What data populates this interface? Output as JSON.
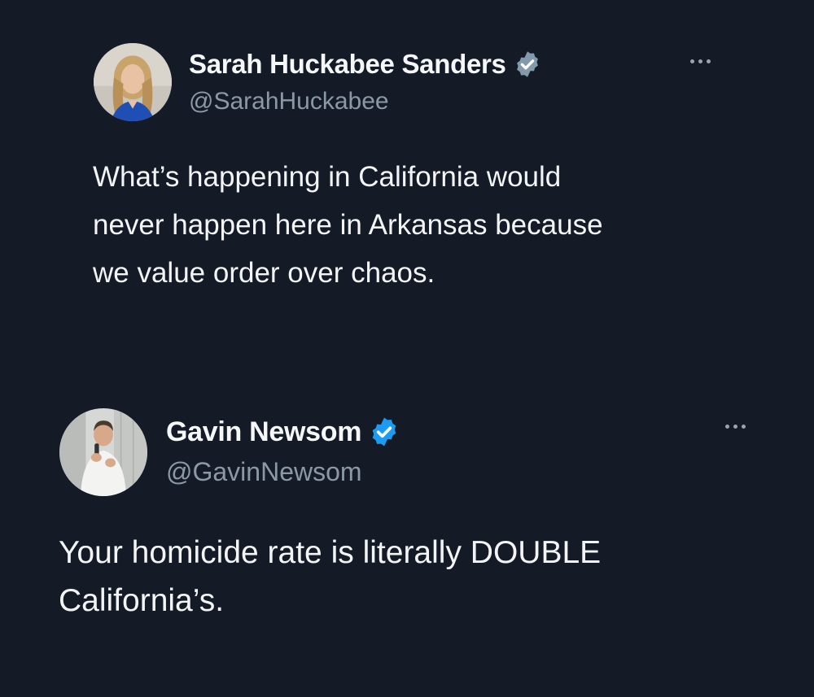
{
  "colors": {
    "background": "#141b26",
    "text_primary": "#f2f4f6",
    "text_secondary": "#8b98a5",
    "verified_gray": "#829aab",
    "verified_blue": "#1d9bf0"
  },
  "tweets": [
    {
      "author": {
        "display_name": "Sarah Huckabee Sanders",
        "handle": "@SarahHuckabee",
        "verified_badge": "verified-gray-badge-icon"
      },
      "more_icon": "more-horizontal-icon",
      "text": "What’s happening in California would\nnever happen here in Arkansas because\nwe value order over chaos."
    },
    {
      "author": {
        "display_name": "Gavin Newsom",
        "handle": "@GavinNewsom",
        "verified_badge": "verified-blue-badge-icon"
      },
      "more_icon": "more-horizontal-icon",
      "text": "Your homicide rate is literally DOUBLE\nCalifornia’s."
    }
  ]
}
